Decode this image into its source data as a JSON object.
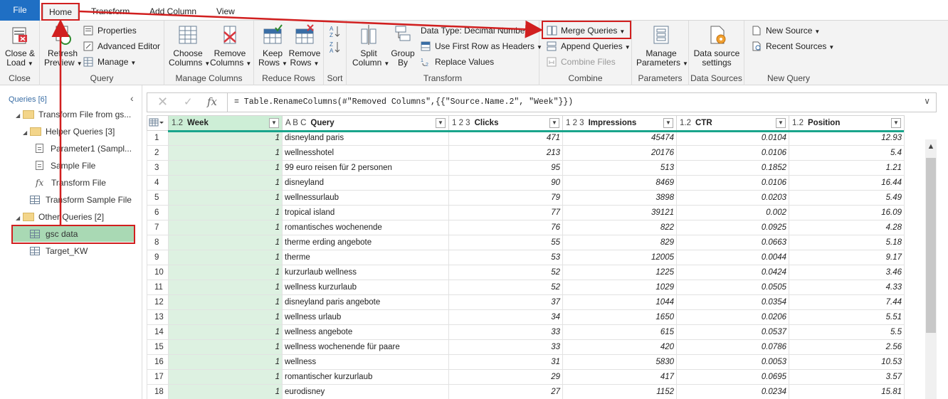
{
  "menu": {
    "file": "File",
    "home": "Home",
    "transform": "Transform",
    "add_column": "Add Column",
    "view": "View"
  },
  "ribbon": {
    "close": {
      "btn": "Close &",
      "btn2": "Load",
      "group": "Close"
    },
    "query": {
      "refresh": "Refresh",
      "refresh2": "Preview",
      "properties": "Properties",
      "advanced_editor": "Advanced Editor",
      "manage": "Manage",
      "group": "Query"
    },
    "manage_columns": {
      "choose": "Choose",
      "choose2": "Columns",
      "remove": "Remove",
      "remove2": "Columns",
      "group": "Manage Columns"
    },
    "reduce_rows": {
      "keep": "Keep",
      "keep2": "Rows",
      "remove": "Remove",
      "remove2": "Rows",
      "group": "Reduce Rows"
    },
    "sort": {
      "group": "Sort"
    },
    "transform": {
      "split": "Split",
      "split2": "Column",
      "group_by": "Group",
      "group_by2": "By",
      "data_type": "Data Type: Decimal Number",
      "first_row": "Use First Row as Headers",
      "replace": "Replace Values",
      "group": "Transform"
    },
    "combine": {
      "merge": "Merge Queries",
      "append": "Append Queries",
      "combine_files": "Combine Files",
      "group": "Combine"
    },
    "parameters": {
      "manage": "Manage",
      "manage2": "Parameters",
      "group": "Parameters"
    },
    "data_sources": {
      "settings": "Data source",
      "settings2": "settings",
      "group": "Data Sources"
    },
    "new_query": {
      "new_source": "New Source",
      "recent_sources": "Recent Sources",
      "group": "New Query"
    }
  },
  "queries": {
    "title": "Queries [6]",
    "items": [
      {
        "label": "Transform File from gs..."
      },
      {
        "label": "Helper Queries [3]"
      },
      {
        "label": "Parameter1 (Sampl..."
      },
      {
        "label": "Sample File"
      },
      {
        "label": "Transform File"
      },
      {
        "label": "Transform Sample File"
      },
      {
        "label": "Other Queries [2]"
      },
      {
        "label": "gsc data"
      },
      {
        "label": "Target_KW"
      }
    ]
  },
  "formula": "= Table.RenameColumns(#\"Removed Columns\",{{\"Source.Name.2\", \"Week\"}})",
  "grid": {
    "columns": [
      {
        "type": "1.2",
        "name": "Week"
      },
      {
        "type": "A B C",
        "name": "Query"
      },
      {
        "type": "1 2 3",
        "name": "Clicks"
      },
      {
        "type": "1 2 3",
        "name": "Impressions"
      },
      {
        "type": "1.2",
        "name": "CTR"
      },
      {
        "type": "1.2",
        "name": "Position"
      }
    ],
    "rows": [
      [
        "1",
        "1",
        "disneyland paris",
        "471",
        "45474",
        "0.0104",
        "12.93"
      ],
      [
        "2",
        "1",
        "wellnesshotel",
        "213",
        "20176",
        "0.0106",
        "5.4"
      ],
      [
        "3",
        "1",
        "99 euro reisen für 2 personen",
        "95",
        "513",
        "0.1852",
        "1.21"
      ],
      [
        "4",
        "1",
        "disneyland",
        "90",
        "8469",
        "0.0106",
        "16.44"
      ],
      [
        "5",
        "1",
        "wellnessurlaub",
        "79",
        "3898",
        "0.0203",
        "5.49"
      ],
      [
        "6",
        "1",
        "tropical island",
        "77",
        "39121",
        "0.002",
        "16.09"
      ],
      [
        "7",
        "1",
        "romantisches wochenende",
        "76",
        "822",
        "0.0925",
        "4.28"
      ],
      [
        "8",
        "1",
        "therme erding angebote",
        "55",
        "829",
        "0.0663",
        "5.18"
      ],
      [
        "9",
        "1",
        "therme",
        "53",
        "12005",
        "0.0044",
        "9.17"
      ],
      [
        "10",
        "1",
        "kurzurlaub wellness",
        "52",
        "1225",
        "0.0424",
        "3.46"
      ],
      [
        "11",
        "1",
        "wellness kurzurlaub",
        "52",
        "1029",
        "0.0505",
        "4.33"
      ],
      [
        "12",
        "1",
        "disneyland paris angebote",
        "37",
        "1044",
        "0.0354",
        "7.44"
      ],
      [
        "13",
        "1",
        "wellness urlaub",
        "34",
        "1650",
        "0.0206",
        "5.51"
      ],
      [
        "14",
        "1",
        "wellness angebote",
        "33",
        "615",
        "0.0537",
        "5.5"
      ],
      [
        "15",
        "1",
        "wellness wochenende für paare",
        "33",
        "420",
        "0.0786",
        "2.56"
      ],
      [
        "16",
        "1",
        "wellness",
        "31",
        "5830",
        "0.0053",
        "10.53"
      ],
      [
        "17",
        "1",
        "romantischer kurzurlaub",
        "29",
        "417",
        "0.0695",
        "3.57"
      ],
      [
        "18",
        "1",
        "eurodisney",
        "27",
        "1152",
        "0.0234",
        "15.81"
      ]
    ]
  },
  "colors": {
    "accent": "#1f6fc4",
    "highlight": "#d11f1f",
    "selected_query": "#a9d9b4",
    "quality_bar": "#1aa58c"
  }
}
